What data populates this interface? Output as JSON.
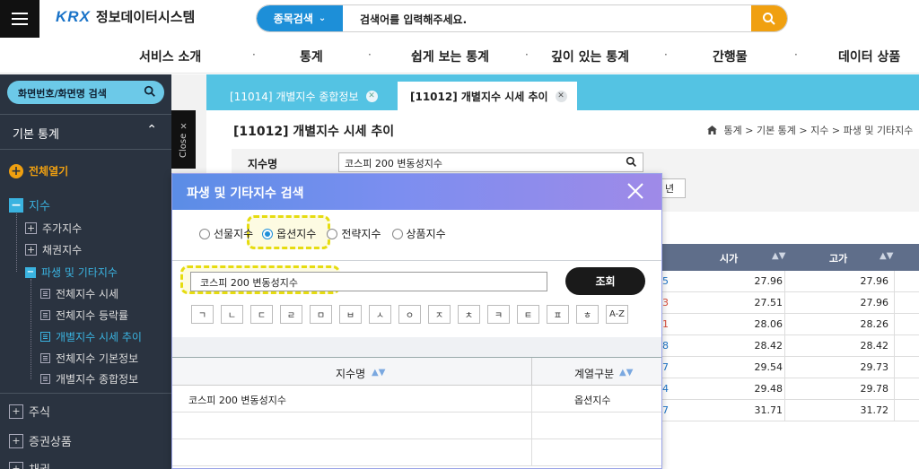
{
  "header": {
    "logo_mark": "KRX",
    "logo_text": "정보데이터시스템",
    "search_category": "종목검색",
    "search_placeholder": "검색어를 입력해주세요."
  },
  "nav": [
    "서비스 소개",
    "통계",
    "쉽게 보는 통계",
    "깊이 있는 통계",
    "간행물",
    "데이터 상품"
  ],
  "sidebar": {
    "search_label": "화면번호/화면명 검색",
    "section_title": "기본 통계",
    "expand_all": "전체열기",
    "items": {
      "index": "지수",
      "stock_index": "주가지수",
      "bond_index": "채권지수",
      "derivatives": "파생 및 기타지수",
      "all_quotes": "전체지수 시세",
      "all_change": "전체지수 등락률",
      "individual_trend": "개별지수 시세 추이",
      "all_basic": "전체지수 기본정보",
      "individual_summary": "개별지수 종합정보",
      "stocks": "주식",
      "securities": "증권상품",
      "bonds": "채권"
    },
    "close_label": "Close ×"
  },
  "tabs": [
    {
      "label": "[11014] 개별지수 종합정보"
    },
    {
      "label": "[11012] 개별지수 시세 추이"
    }
  ],
  "page": {
    "title": "[11012] 개별지수 시세 추이",
    "breadcrumb": "통계 > 기본 통계 > 지수 > 파생 및 기타지수",
    "filter_label": "지수명",
    "filter_value": "코스피 200 변동성지수",
    "year_button": "년"
  },
  "bg_table": {
    "headers": [
      "시가",
      "고가"
    ],
    "rows": [
      {
        "code": "5",
        "open": "27.96",
        "high": "27.96"
      },
      {
        "code": "3",
        "open": "27.51",
        "high": "27.96"
      },
      {
        "code": "1",
        "open": "28.06",
        "high": "28.26"
      },
      {
        "code": "8",
        "open": "28.42",
        "high": "28.42"
      },
      {
        "code": "7",
        "open": "29.54",
        "high": "29.73"
      },
      {
        "code": "4",
        "open": "29.48",
        "high": "29.78"
      },
      {
        "code": "7",
        "open": "31.71",
        "high": "31.72"
      }
    ]
  },
  "modal": {
    "title": "파생 및 기타지수 검색",
    "radios": [
      "선물지수",
      "옵션지수",
      "전략지수",
      "상품지수"
    ],
    "selected_radio": "옵션지수",
    "input_value": "코스피 200 변동성지수",
    "query_button": "조회",
    "keys": [
      "ㄱ",
      "ㄴ",
      "ㄷ",
      "ㄹ",
      "ㅁ",
      "ㅂ",
      "ㅅ",
      "ㅇ",
      "ㅈ",
      "ㅊ",
      "ㅋ",
      "ㅌ",
      "ㅍ",
      "ㅎ",
      "A-Z"
    ],
    "table_headers": [
      "지수명",
      "계열구분"
    ],
    "results": [
      {
        "name": "코스피 200 변동성지수",
        "group": "옵션지수"
      }
    ]
  },
  "colors": {
    "accent_blue": "#1d8fd8",
    "tab_cyan": "#54c3e3",
    "sidebar_bg": "#2a3340",
    "search_button": "#f0a010",
    "highlight": "#e6dc10"
  }
}
